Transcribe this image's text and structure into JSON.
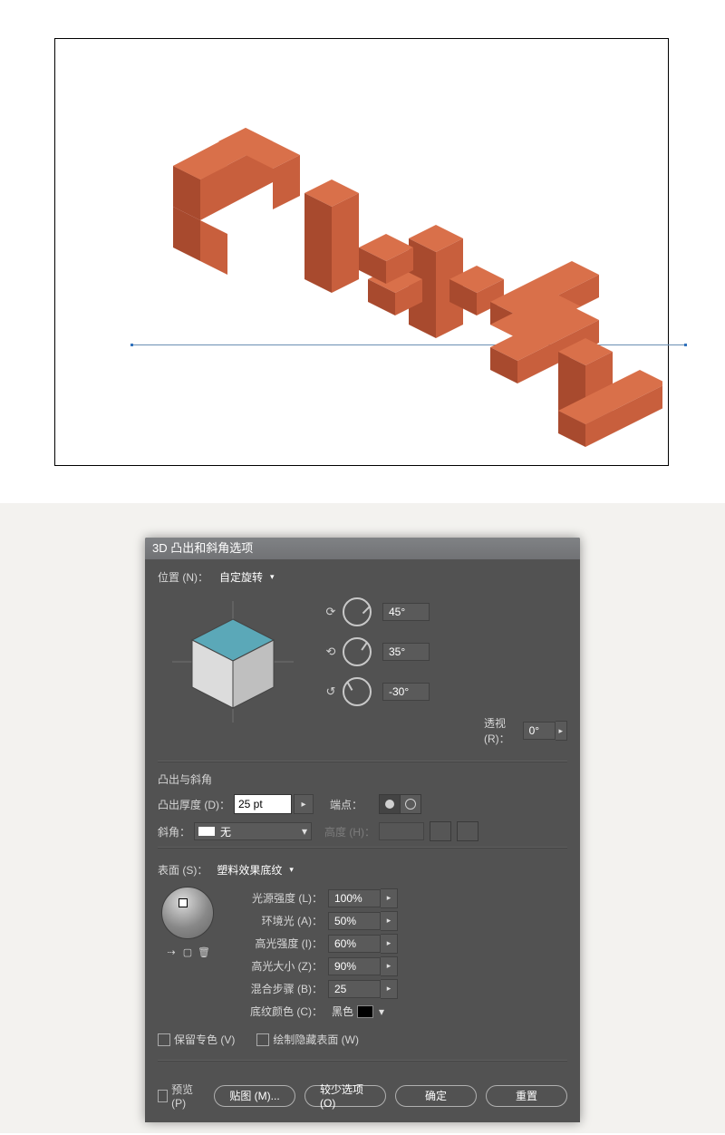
{
  "canvas": {
    "text": "PIXEL",
    "color_top": "#d9704a",
    "color_left": "#a84a2e",
    "color_right": "#c85f3d"
  },
  "dialog": {
    "title": "3D 凸出和斜角选项",
    "position_label": "位置 (N)：",
    "position_value": "自定旋转",
    "rot_x": "45°",
    "rot_y": "35°",
    "rot_z": "-30°",
    "perspective_label": "透视 (R)：",
    "perspective_value": "0°",
    "extrude_title": "凸出与斜角",
    "depth_label": "凸出厚度 (D)：",
    "depth_value": "25 pt",
    "cap_label": "端点：",
    "bevel_label": "斜角：",
    "bevel_value": "无",
    "dim_height_label": "高度 (H)：",
    "surface_label": "表面 (S)：",
    "surface_value": "塑料效果底纹",
    "light_intensity_label": "光源强度 (L)：",
    "light_intensity_value": "100%",
    "ambient_label": "环境光 (A)：",
    "ambient_value": "50%",
    "highlight_intensity_label": "高光强度 (I)：",
    "highlight_intensity_value": "60%",
    "highlight_size_label": "高光大小 (Z)：",
    "highlight_size_value": "90%",
    "blend_steps_label": "混合步骤 (B)：",
    "blend_steps_value": "25",
    "shading_color_label": "底纹颜色 (C)：",
    "shading_color_value": "黑色",
    "preserve_spot_label": "保留专色 (V)",
    "draw_hidden_label": "绘制隐藏表面 (W)",
    "preview_label": "预览 (P)",
    "map_art_btn": "贴图 (M)...",
    "fewer_btn": "较少选项 (O)",
    "ok_btn": "确定",
    "reset_btn": "重置"
  }
}
